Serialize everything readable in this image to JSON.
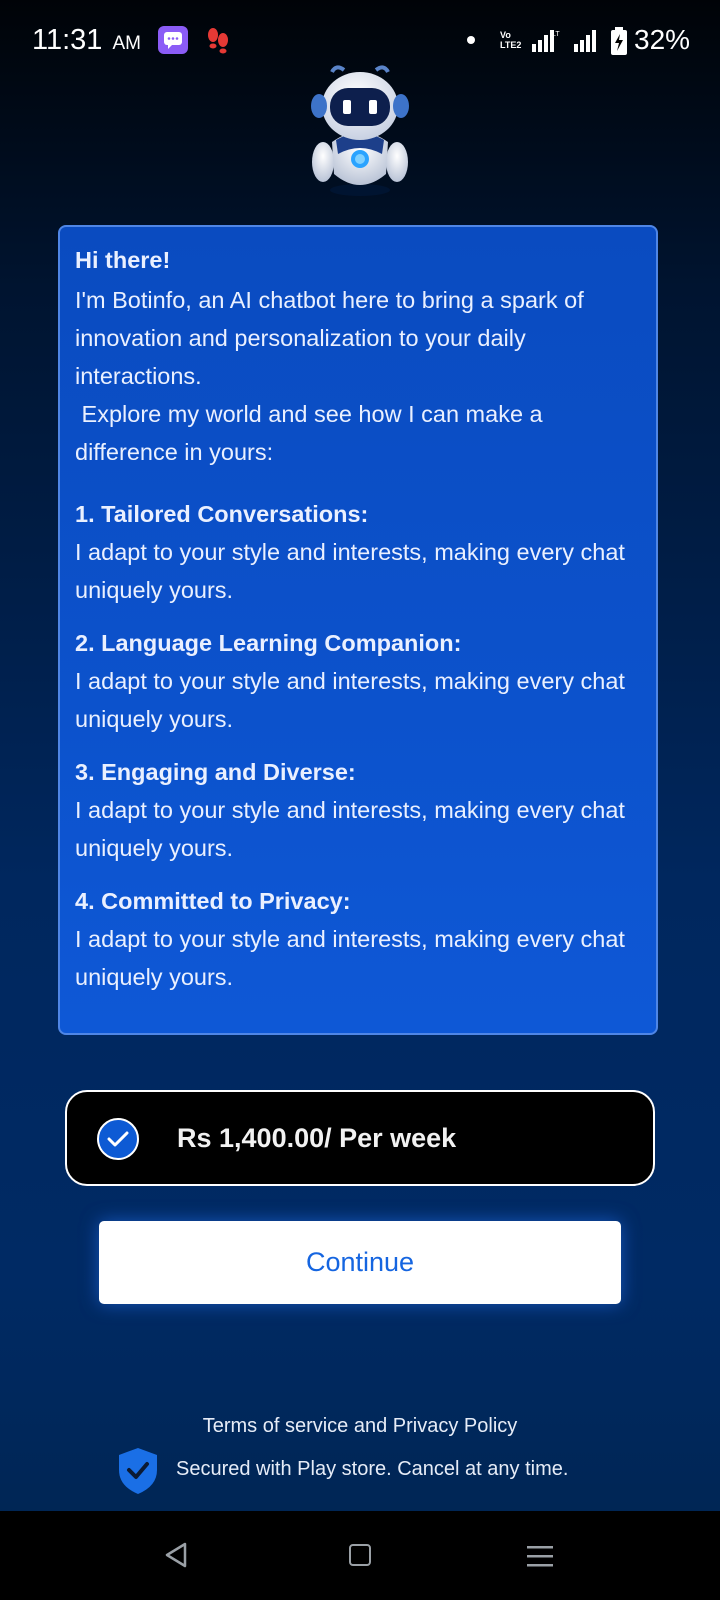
{
  "status_bar": {
    "time": "11:31",
    "ampm": "AM",
    "network_label": "Vo LTE2",
    "battery_percent": "32%"
  },
  "intro": {
    "greeting": "Hi there!",
    "paragraph1": "I'm Botinfo, an AI chatbot here to bring a spark of innovation and personalization to your daily interactions.",
    "paragraph2": " Explore my world and see how I can make a difference in yours:",
    "features": [
      {
        "title": "1. Tailored Conversations:",
        "desc": "I adapt to your style and interests, making every chat uniquely yours."
      },
      {
        "title": "2. Language Learning Companion:",
        "desc": "I adapt to your style and interests, making every chat uniquely yours."
      },
      {
        "title": "3. Engaging and Diverse:",
        "desc": "I adapt to your style and interests, making every chat uniquely yours."
      },
      {
        "title": "4. Committed to Privacy:",
        "desc": "I adapt to your style and interests, making every chat uniquely yours."
      }
    ]
  },
  "plan": {
    "price": "Rs 1,400.00/ Per week",
    "selected": true
  },
  "continue_label": "Continue",
  "footer": {
    "terms": "Terms of service and Privacy Policy",
    "secure": "Secured with Play store. Cancel at any time."
  },
  "colors": {
    "accent": "#1565e0",
    "card": "#0c52cc",
    "background": "#00275e"
  }
}
